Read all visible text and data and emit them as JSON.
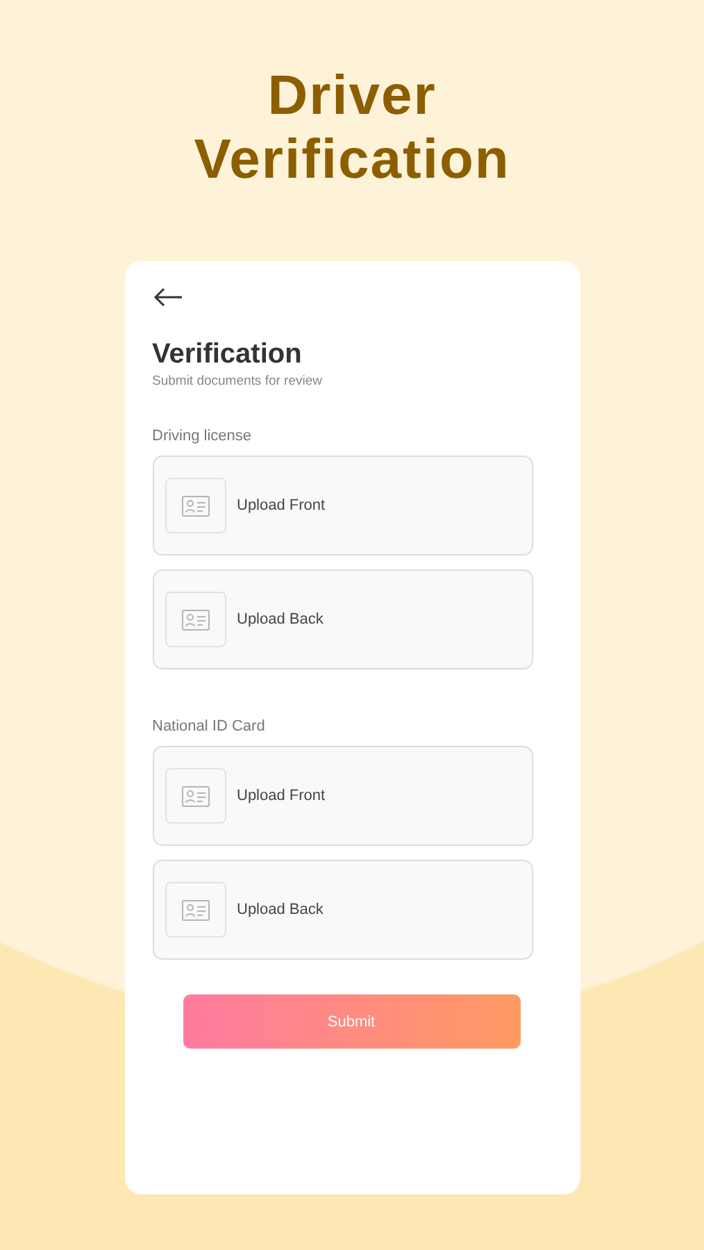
{
  "headline": "Driver Verification",
  "screen": {
    "title": "Verification",
    "subtitle": "Submit documents for review"
  },
  "sections": [
    {
      "label": "Driving license",
      "uploads": [
        "Upload Front",
        "Upload Back"
      ]
    },
    {
      "label": "National ID Card",
      "uploads": [
        "Upload Front",
        "Upload Back"
      ]
    }
  ],
  "submit": {
    "label": "Submit"
  }
}
